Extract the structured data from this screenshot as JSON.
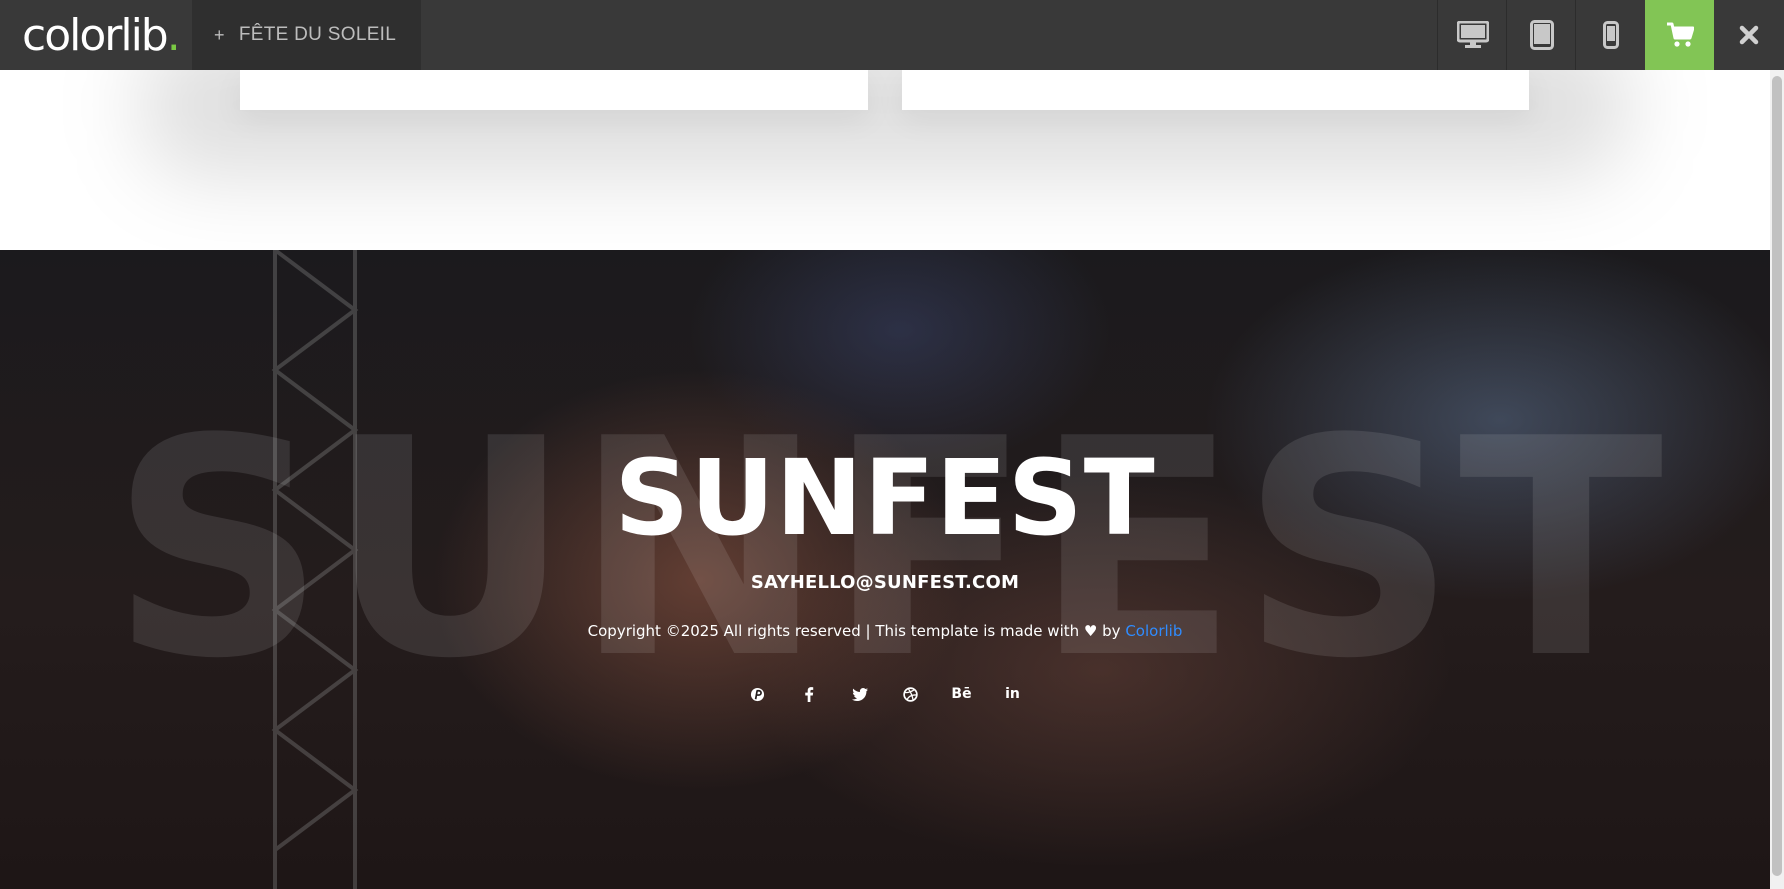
{
  "topbar": {
    "logo_text": "colorlib",
    "logo_dot": ".",
    "theme_tab": {
      "icon": "plus-icon",
      "label": "FÊTE DU SOLEIL"
    },
    "devices": [
      {
        "name": "desktop",
        "icon": "desktop-icon"
      },
      {
        "name": "tablet",
        "icon": "tablet-icon"
      },
      {
        "name": "mobile",
        "icon": "mobile-icon"
      }
    ],
    "cart_icon": "cart-icon",
    "close_icon": "close-icon",
    "accent_color": "#82c555"
  },
  "footer": {
    "background_word": "SUNFEST",
    "brand": "SUNFEST",
    "email": "SAYHELLO@SUNFEST.COM",
    "copyright_prefix": "Copyright ©2025 All rights reserved | This template is made with",
    "copyright_by": "by",
    "copyright_link": "Colorlib",
    "link_color": "#2f8cff",
    "social": [
      {
        "icon": "pinterest-icon",
        "glyph": "P"
      },
      {
        "icon": "facebook-icon",
        "glyph": "f"
      },
      {
        "icon": "twitter-icon",
        "glyph": "t"
      },
      {
        "icon": "dribbble-icon",
        "glyph": "◎"
      },
      {
        "icon": "behance-icon",
        "glyph": "Bē"
      },
      {
        "icon": "linkedin-icon",
        "glyph": "in"
      }
    ]
  }
}
